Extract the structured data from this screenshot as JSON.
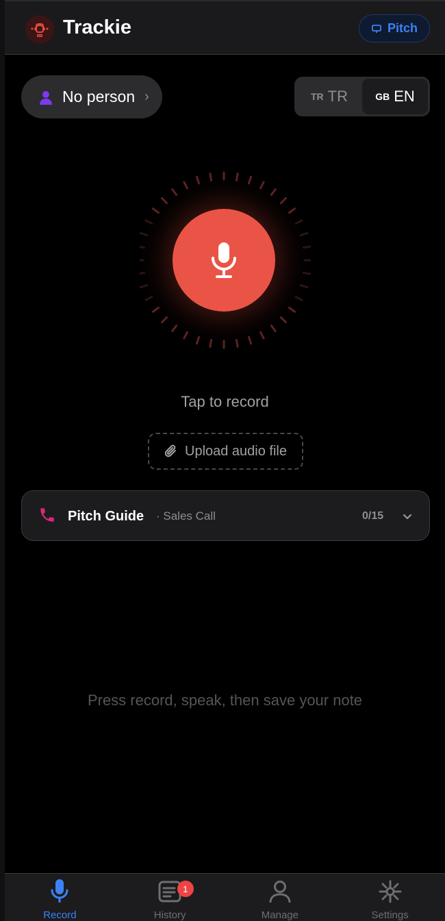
{
  "header": {
    "app_title": "Trackie",
    "pitch_button_label": "Pitch",
    "logo_icon": "trackie-logo-icon"
  },
  "person_selector": {
    "label": "No person",
    "chevron": "›",
    "icon": "person-icon"
  },
  "language_toggle": {
    "options": [
      {
        "flag": "TR",
        "label": "TR",
        "active": false
      },
      {
        "flag": "GB",
        "label": "EN",
        "active": true
      }
    ]
  },
  "recorder": {
    "hint": "Tap to record",
    "upload_label": "Upload audio file",
    "accent_color": "#ea5446",
    "mic_icon": "microphone-icon"
  },
  "pitch_guide": {
    "title": "Pitch Guide",
    "subtitle": "· Sales Call",
    "progress": "0/15",
    "icon": "phone-icon"
  },
  "empty_state": {
    "text": "Press record, speak, then save your note"
  },
  "bottom_nav": {
    "items": [
      {
        "label": "Record",
        "icon": "microphone-icon",
        "active": true
      },
      {
        "label": "History",
        "icon": "history-icon",
        "badge": "1"
      },
      {
        "label": "Manage",
        "icon": "user-icon"
      },
      {
        "label": "Settings",
        "icon": "settings-icon"
      }
    ],
    "active_color": "#3b82f6"
  }
}
